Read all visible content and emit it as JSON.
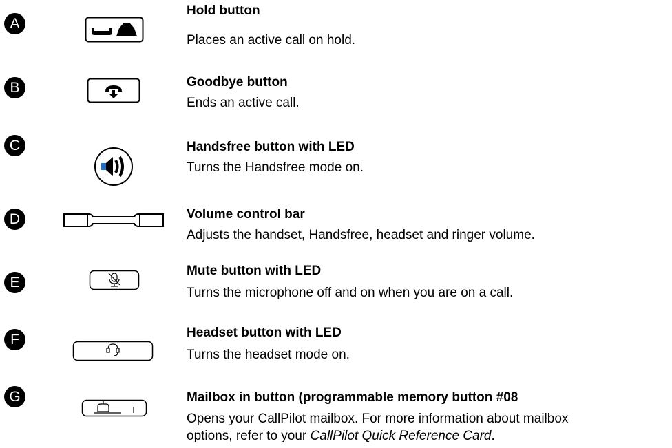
{
  "items": [
    {
      "letter": "A",
      "title": "Hold button",
      "desc": "Places an active call on hold."
    },
    {
      "letter": "B",
      "title": "Goodbye button",
      "desc": "Ends an active call."
    },
    {
      "letter": "C",
      "title": "Handsfree button with LED",
      "desc": "Turns the Handsfree mode on."
    },
    {
      "letter": "D",
      "title": "Volume control bar",
      "desc": "Adjusts the handset, Handsfree, headset and ringer volume."
    },
    {
      "letter": "E",
      "title": "Mute button with LED",
      "desc": "Turns the microphone off and on when you are on a call."
    },
    {
      "letter": "F",
      "title": "Headset button with LED",
      "desc": "Turns the headset mode on."
    },
    {
      "letter": "G",
      "title": "Mailbox in button (programmable memory button #08",
      "desc_line1": "Opens your CallPilot mailbox. For more information about mailbox",
      "desc_line2_pre": "options, refer to your ",
      "desc_line2_italic": "CallPilot Quick Reference Card",
      "desc_line2_post": "."
    }
  ],
  "icons": [
    "hold-icon",
    "goodbye-icon",
    "handsfree-icon",
    "volume-bar-icon",
    "mute-icon",
    "headset-icon",
    "mailbox-icon"
  ]
}
